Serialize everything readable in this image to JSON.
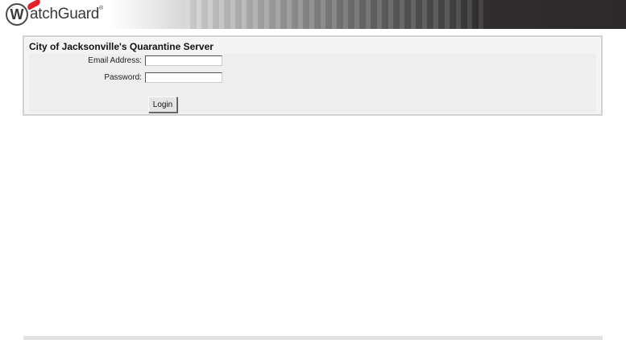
{
  "header": {
    "logo_text": "atchGuard",
    "logo_letter": "W",
    "logo_reg": "®"
  },
  "panel": {
    "title": "City of Jacksonville's Quarantine Server",
    "email_label": "Email Address:",
    "email_value": "",
    "password_label": "Password:",
    "password_value": "",
    "login_label": "Login"
  },
  "colors": {
    "brand_red": "#e2202a",
    "header_dark": "#2b2929",
    "panel_bg": "#f4f4f4",
    "panel_border": "#d3d3d3"
  }
}
